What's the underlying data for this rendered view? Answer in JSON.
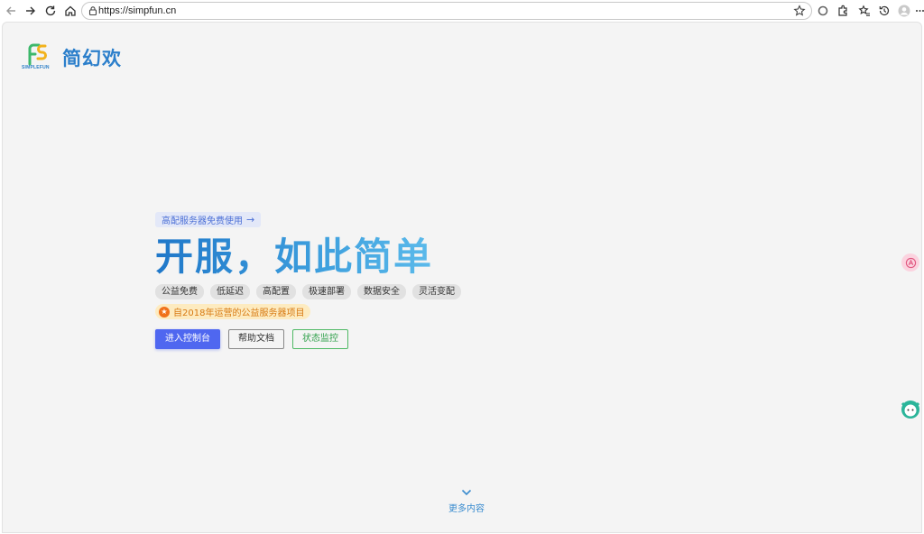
{
  "browser": {
    "url": "https://simpfun.cn"
  },
  "brand": {
    "logo_caption": "SIMPLEFUN",
    "name": "简幻欢"
  },
  "hero": {
    "promo": "高配服务器免费使用",
    "headline": "开服，如此简单",
    "tags": [
      "公益免费",
      "低延迟",
      "高配置",
      "极速部署",
      "数据安全",
      "灵活变配"
    ],
    "notice": "自2018年运营的公益服务器项目",
    "buttons": {
      "console": "进入控制台",
      "docs": "帮助文档",
      "status": "状态监控"
    }
  },
  "footer": {
    "more": "更多内容"
  },
  "colors": {
    "brand": "#2c7fcb",
    "primary_button": "#4f67f0",
    "status_green": "#2fa04a",
    "notice_orange": "#f0711a"
  }
}
